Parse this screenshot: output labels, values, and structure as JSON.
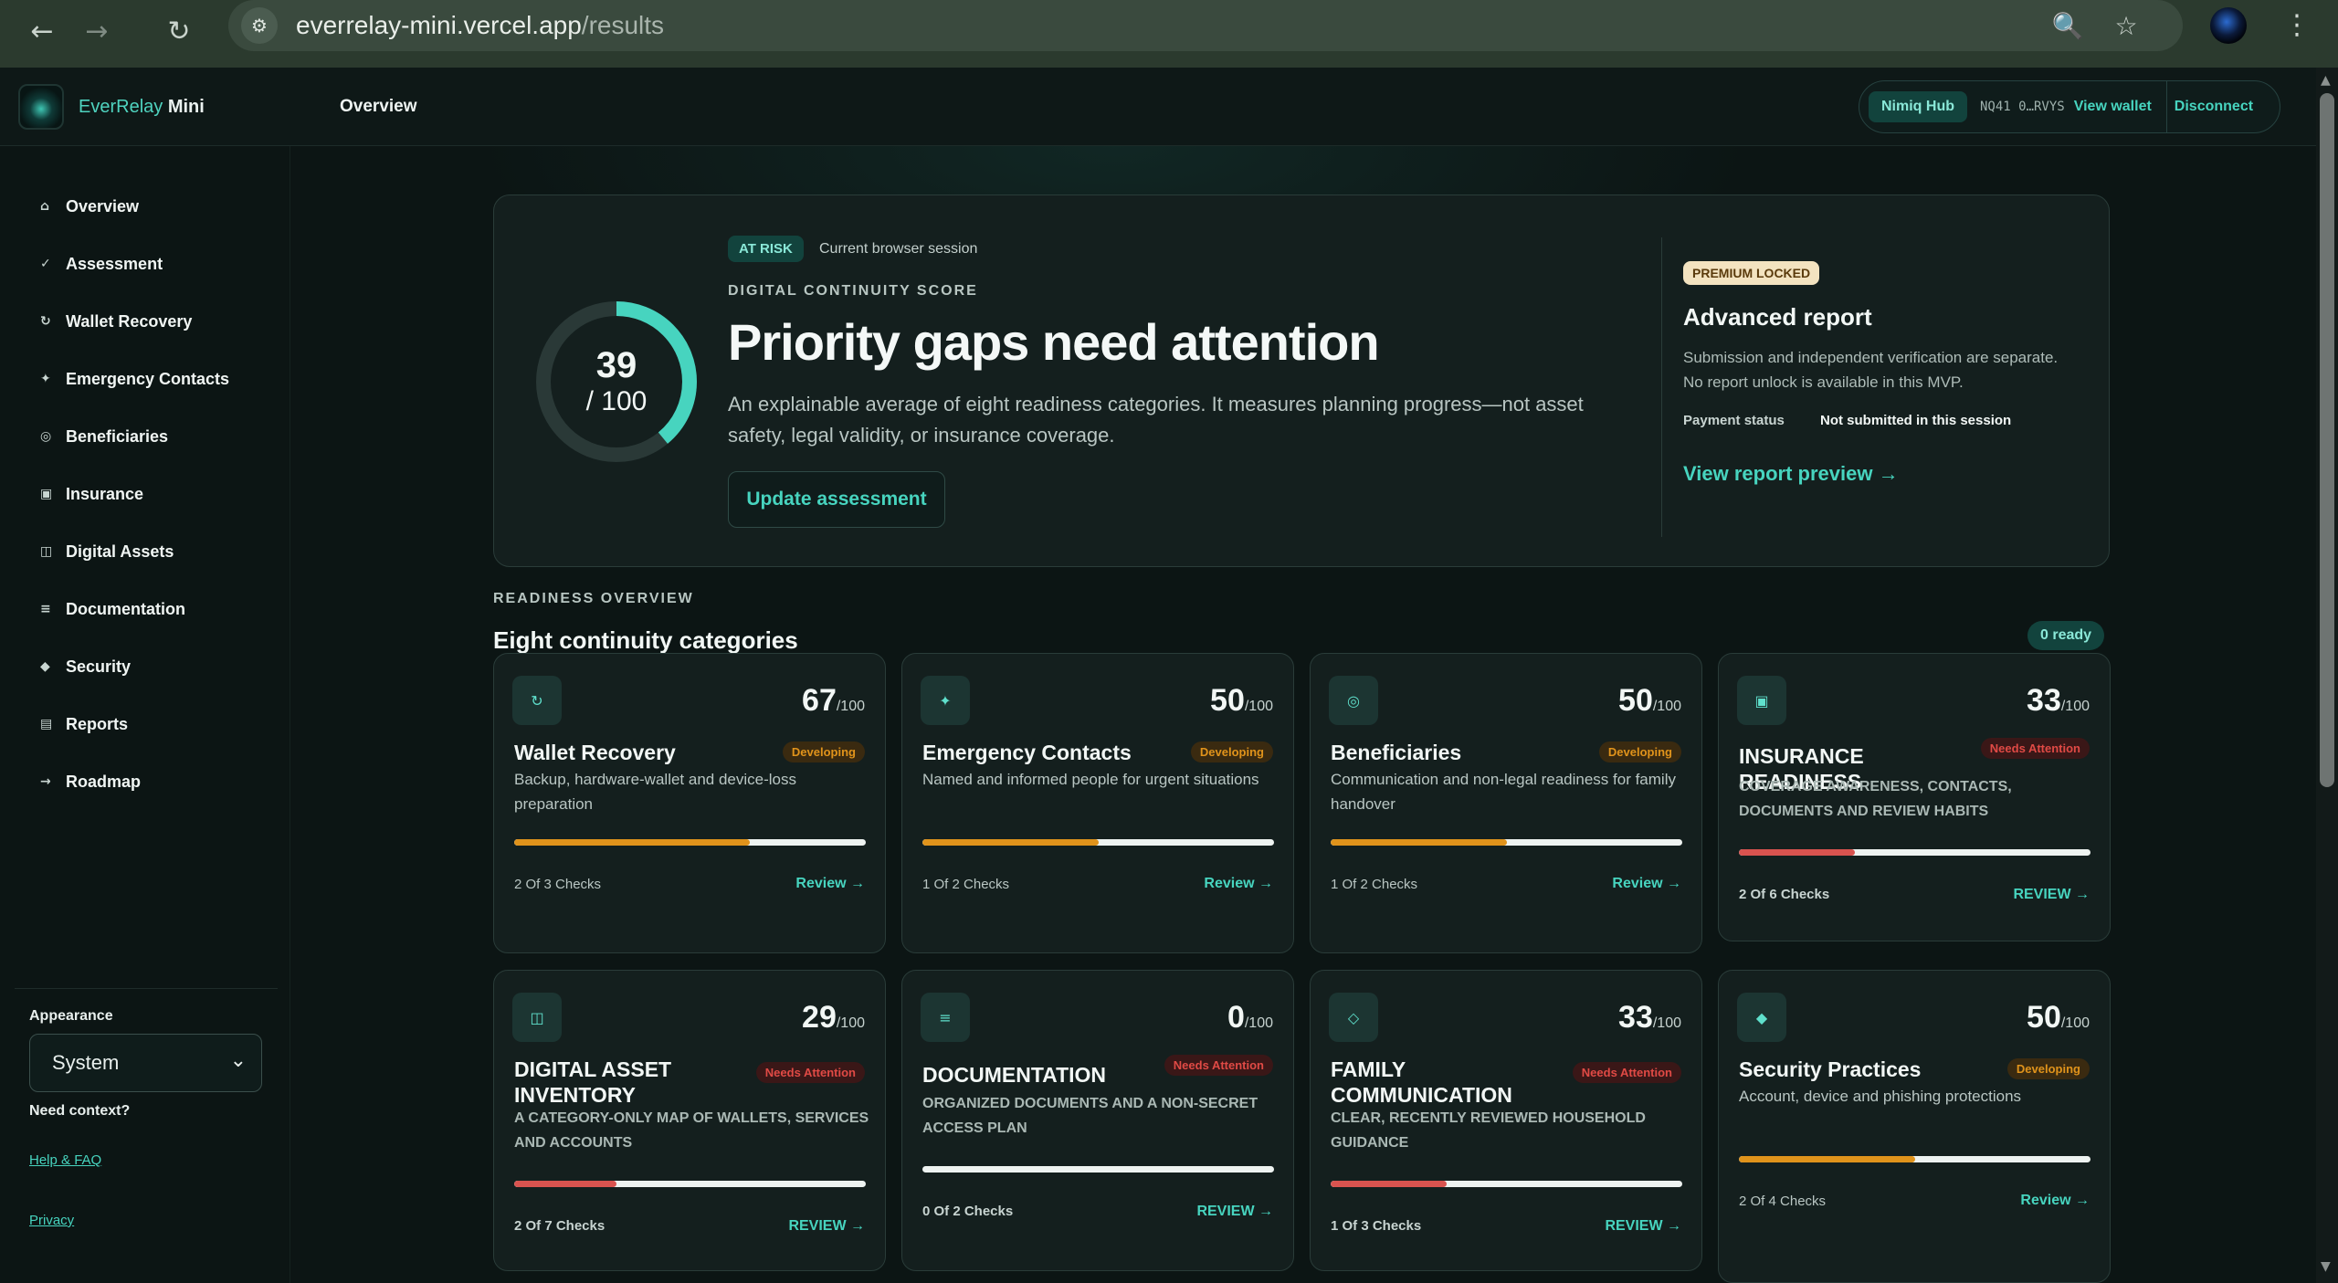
{
  "browser": {
    "url_host": "everrelay-mini.vercel.app",
    "url_path": "/results",
    "back_icon": "←",
    "forward_icon": "→",
    "reload_icon": "↻",
    "tune_icon": "⚙",
    "zoom_icon": "🔍",
    "star_icon": "☆",
    "menu_icon": "⋮"
  },
  "header": {
    "brand_name": "EverRelay",
    "brand_suffix": "Mini",
    "tab": "Overview",
    "wallet": {
      "hub": "Nimiq Hub",
      "address": "NQ41 0…RVYS",
      "view": "View wallet",
      "disconnect": "Disconnect"
    }
  },
  "sidebar": {
    "items": [
      {
        "icon": "⌂",
        "label": "Overview"
      },
      {
        "icon": "✓",
        "label": "Assessment"
      },
      {
        "icon": "↻",
        "label": "Wallet Recovery"
      },
      {
        "icon": "✦",
        "label": "Emergency Contacts"
      },
      {
        "icon": "◎",
        "label": "Beneficiaries"
      },
      {
        "icon": "▣",
        "label": "Insurance"
      },
      {
        "icon": "◫",
        "label": "Digital Assets"
      },
      {
        "icon": "≡",
        "label": "Documentation"
      },
      {
        "icon": "◆",
        "label": "Security"
      },
      {
        "icon": "▤",
        "label": "Reports"
      },
      {
        "icon": "→",
        "label": "Roadmap"
      }
    ],
    "appearance_label": "Appearance",
    "appearance_value": "System",
    "chevron": "⌄",
    "need_context": "Need context?",
    "help_link": "Help & FAQ",
    "privacy_link": "Privacy"
  },
  "hero": {
    "score": "39",
    "score_denom": "/ 100",
    "score_fraction": 0.39,
    "status_badge": "AT RISK",
    "session": "Current browser session",
    "kicker": "DIGITAL CONTINUITY SCORE",
    "headline": "Priority gaps need attention",
    "description": "An explainable average of eight readiness categories. It measures planning progress—not asset safety, legal validity, or insurance coverage.",
    "update_button": "Update assessment",
    "premium_badge": "PREMIUM LOCKED",
    "advanced_title": "Advanced report",
    "advanced_desc": "Submission and independent verification are separate. No report unlock is available in this MVP.",
    "payment_label": "Payment status",
    "payment_value": "Not submitted in this session",
    "preview_link": "View report preview →"
  },
  "readiness": {
    "kicker": "READINESS OVERVIEW",
    "title": "Eight continuity categories",
    "ready_count": "0 ready",
    "cards": [
      {
        "icon": "↻",
        "score": "67",
        "denom": "/100",
        "title": "Wallet Recovery",
        "badge": "Developing",
        "desc": "Backup, hardware-wallet and device-loss preparation",
        "progress": 0.67,
        "checks": "2 Of 3 Checks",
        "review": "Review →"
      },
      {
        "icon": "✦",
        "score": "50",
        "denom": "/100",
        "title": "Emergency Contacts",
        "badge": "Developing",
        "desc": "Named and informed people for urgent situations",
        "progress": 0.5,
        "checks": "1 Of 2 Checks",
        "review": "Review →"
      },
      {
        "icon": "◎",
        "score": "50",
        "denom": "/100",
        "title": "Beneficiaries",
        "badge": "Developing",
        "desc": "Communication and non-legal readiness for family handover",
        "progress": 0.5,
        "checks": "1 Of 2 Checks",
        "review": "Review →"
      },
      {
        "icon": "▣",
        "score": "33",
        "denom": "/100",
        "title": "Insurance Readiness",
        "badge": "Needs Attention",
        "desc": "Coverage awareness, contacts, documents and review habits",
        "progress": 0.33,
        "checks": "2 Of 6 Checks",
        "review": "Review →"
      },
      {
        "icon": "◫",
        "score": "29",
        "denom": "/100",
        "title": "Digital Asset Inventory",
        "badge": "Needs Attention",
        "desc": "A category-only map of wallets, services and accounts",
        "progress": 0.29,
        "checks": "2 Of 7 Checks",
        "review": "Review →"
      },
      {
        "icon": "≡",
        "score": "0",
        "denom": "/100",
        "title": "Documentation",
        "badge": "Needs Attention",
        "desc": "Organized documents and a non-secret access plan",
        "progress": 0,
        "checks": "0 Of 2 Checks",
        "review": "Review →"
      },
      {
        "icon": "◇",
        "score": "33",
        "denom": "/100",
        "title": "Family Communication",
        "badge": "Needs Attention",
        "desc": "Clear, recently reviewed household guidance",
        "progress": 0.33,
        "checks": "1 Of 3 Checks",
        "review": "Review →"
      },
      {
        "icon": "◆",
        "score": "50",
        "denom": "/100",
        "title": "Security Practices",
        "badge": "Developing",
        "desc": "Account, device and phishing protections",
        "progress": 0.5,
        "checks": "2 Of 4 Checks",
        "review": "Review →"
      }
    ]
  },
  "colors": {
    "accent": "#47d4bf",
    "developing": "#e0931b",
    "needs_attention": "#d9534f"
  }
}
